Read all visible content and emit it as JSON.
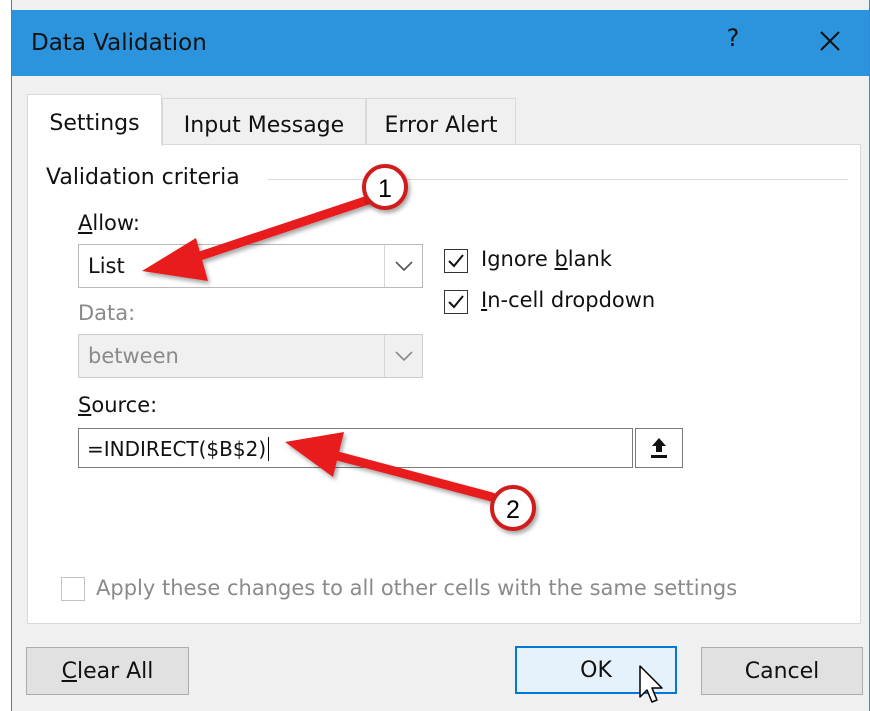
{
  "window": {
    "title": "Data Validation",
    "help_label": "?"
  },
  "tabs": [
    {
      "label": "Settings",
      "active": true
    },
    {
      "label": "Input Message",
      "active": false
    },
    {
      "label": "Error Alert",
      "active": false
    }
  ],
  "criteria": {
    "group_label": "Validation criteria",
    "allow": {
      "label_mnemonic": "A",
      "label_rest": "llow:",
      "value": "List"
    },
    "data": {
      "label": "Data:",
      "value": "between",
      "disabled": true
    },
    "ignore_blank": {
      "label_pre": "Ignore ",
      "label_mnemonic": "b",
      "label_post": "lank",
      "checked": true
    },
    "in_cell_dropdown": {
      "label_mnemonic": "I",
      "label_rest": "n-cell dropdown",
      "checked": true
    },
    "source": {
      "label_mnemonic": "S",
      "label_rest": "ource:",
      "value": "=INDIRECT($B$2)"
    }
  },
  "apply_all": {
    "label": "Apply these changes to all other cells with the same settings",
    "checked": false,
    "disabled": true
  },
  "buttons": {
    "clear_mnemonic": "C",
    "clear_rest": "lear All",
    "ok": "OK",
    "cancel": "Cancel"
  },
  "annotations": [
    {
      "number": "1"
    },
    {
      "number": "2"
    }
  ],
  "colors": {
    "titlebar": "#2b94dd",
    "annotation_arrow": "#e81c1c",
    "default_button_border": "#0078d7"
  }
}
